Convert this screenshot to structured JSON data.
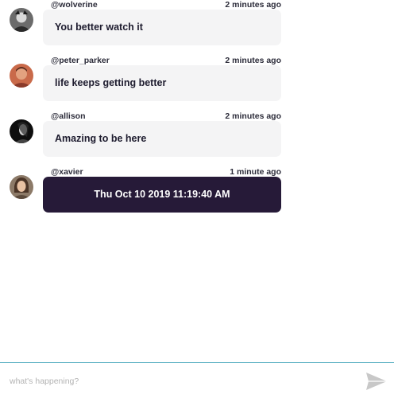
{
  "messages": [
    {
      "username": "@wolverine",
      "time": "2 minutes ago",
      "text": "You better watch it",
      "own": false,
      "avatar_icon": "user-avatar-icon"
    },
    {
      "username": "@peter_parker",
      "time": "2 minutes ago",
      "text": "life keeps getting better",
      "own": false,
      "avatar_icon": "user-avatar-icon"
    },
    {
      "username": "@allison",
      "time": "2 minutes ago",
      "text": "Amazing to be here",
      "own": false,
      "avatar_icon": "user-avatar-icon"
    },
    {
      "username": "@xavier",
      "time": "1 minute ago",
      "text": "Thu Oct 10 2019 11:19:40 AM",
      "own": true,
      "avatar_icon": "user-avatar-icon"
    }
  ],
  "composer": {
    "placeholder": "what's happening?",
    "value": "",
    "send_icon": "send-icon"
  },
  "colors": {
    "own_bubble": "#261a38",
    "other_bubble": "#f4f4f5",
    "divider": "#5fb3c4",
    "send_icon": "#c8c8c8"
  }
}
